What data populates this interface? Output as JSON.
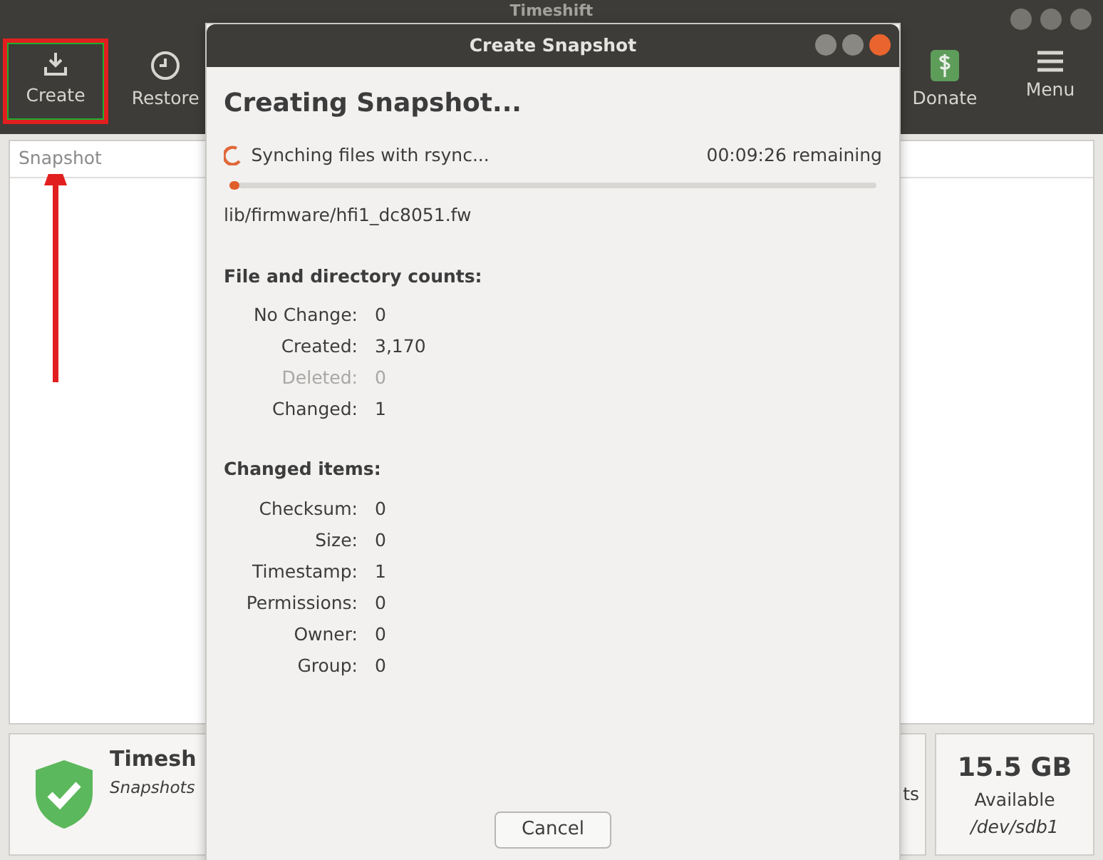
{
  "main_window": {
    "title": "Timeshift",
    "toolbar_left": [
      {
        "label": "Create",
        "highlighted": true
      },
      {
        "label": "Restore",
        "highlighted": false
      }
    ],
    "toolbar_right": [
      {
        "label": "Donate"
      },
      {
        "label": "Menu"
      }
    ],
    "table": {
      "columns": [
        "Snapshot"
      ]
    },
    "status": {
      "title": "Timesh",
      "subtitle": "Snapshots",
      "middle_fragment": "ts"
    },
    "disk": {
      "size": "15.5 GB",
      "label": "Available",
      "device": "/dev/sdb1"
    }
  },
  "dialog": {
    "title": "Create Snapshot",
    "heading": "Creating Snapshot...",
    "status": "Synching files with rsync...",
    "remaining": "00:09:26 remaining",
    "level": 0.01,
    "current_file": "lib/firmware/hfi1_dc8051.fw",
    "sections": [
      {
        "title": "File and directory counts:",
        "rows": [
          {
            "label": "No Change:",
            "value": "0",
            "disabled": false
          },
          {
            "label": "Created:",
            "value": "3,170",
            "disabled": false
          },
          {
            "label": "Deleted:",
            "value": "0",
            "disabled": true
          },
          {
            "label": "Changed:",
            "value": "1",
            "disabled": false
          }
        ]
      },
      {
        "title": "Changed items:",
        "rows": [
          {
            "label": "Checksum:",
            "value": "0",
            "disabled": false
          },
          {
            "label": "Size:",
            "value": "0",
            "disabled": false
          },
          {
            "label": "Timestamp:",
            "value": "1",
            "disabled": false
          },
          {
            "label": "Permissions:",
            "value": "0",
            "disabled": false
          },
          {
            "label": "Owner:",
            "value": "0",
            "disabled": false
          },
          {
            "label": "Group:",
            "value": "0",
            "disabled": false
          }
        ]
      }
    ],
    "cancel_button": "Cancel"
  }
}
